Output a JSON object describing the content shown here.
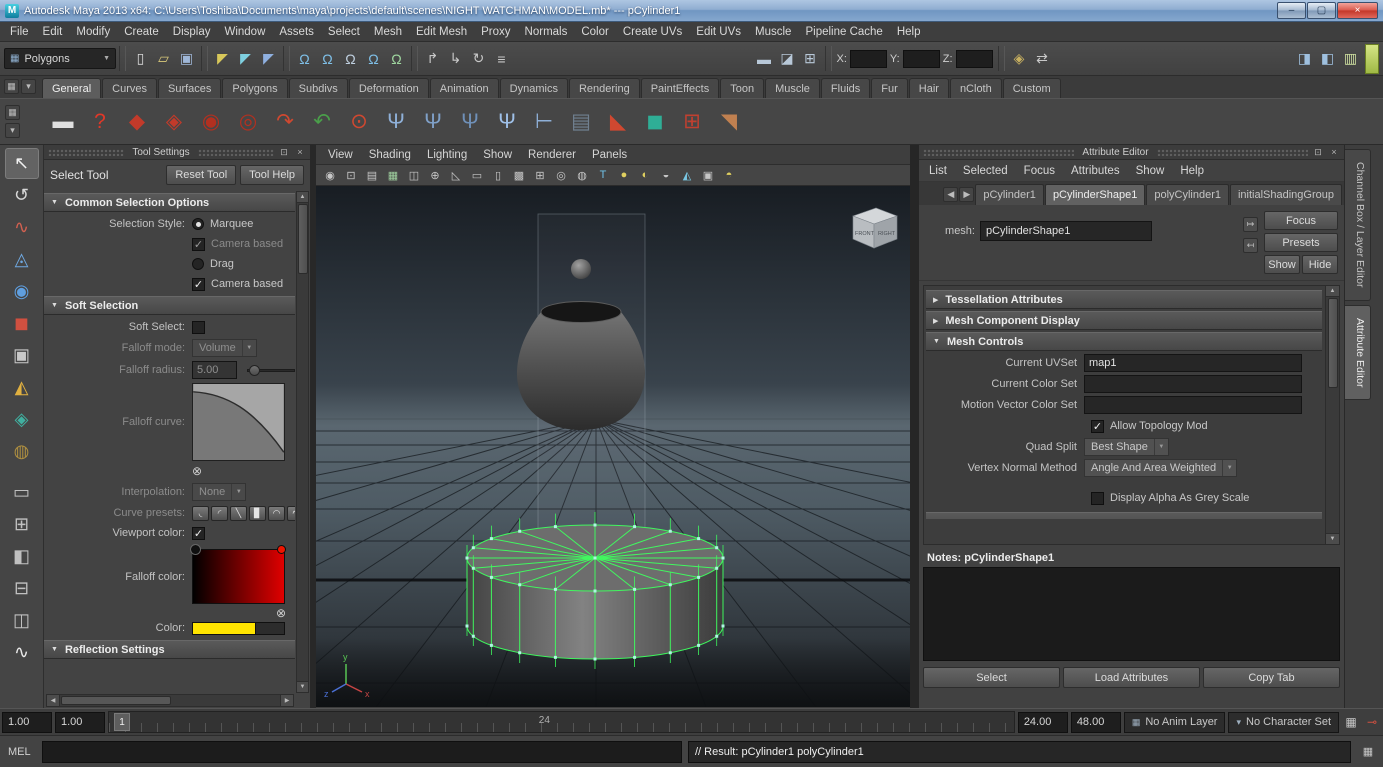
{
  "glyphs": {
    "menu_grid": "▦",
    "menu_arrow": "▾",
    "combo_arrow": "▼",
    "tri_down": "▼",
    "tri_right": "▶",
    "tri_up": "▲",
    "tri_left": "◀",
    "check": "✓",
    "close": "×",
    "dock": "⊡",
    "circle_cross": "⊗",
    "arrow_in": "↦",
    "arrow_out": "↤",
    "min": "–",
    "max": "▢",
    "key": "⊸",
    "maya_badge": "M"
  },
  "titlebar": {
    "title": "Autodesk Maya 2013 x64: C:\\Users\\Toshiba\\Documents\\maya\\projects\\default\\scenes\\NIGHT WATCHMAN\\MODEL.mb*    ---    pCylinder1"
  },
  "menubar": {
    "items": [
      "File",
      "Edit",
      "Modify",
      "Create",
      "Display",
      "Window",
      "Assets",
      "Select",
      "Mesh",
      "Edit Mesh",
      "Proxy",
      "Normals",
      "Color",
      "Create UVs",
      "Edit UVs",
      "Muscle",
      "Pipeline Cache",
      "Help"
    ]
  },
  "statusline": {
    "mode_selector": "Polygons",
    "coord_labels": {
      "x": "X:",
      "y": "Y:",
      "z": "Z:"
    },
    "file_icons": [
      {
        "id": "new-scene-icon",
        "glyph": "▯",
        "color": "#d8d8d8"
      },
      {
        "id": "open-scene-icon",
        "glyph": "▱",
        "color": "#d8c87a"
      },
      {
        "id": "save-scene-icon",
        "glyph": "▣",
        "color": "#9fb7d8"
      }
    ],
    "selection_mask_icons": [
      {
        "id": "select-hierarchy-icon",
        "glyph": "◤",
        "color": "#d8c85a"
      },
      {
        "id": "select-object-icon",
        "glyph": "◤",
        "color": "#7fd0e0"
      },
      {
        "id": "select-component-icon",
        "glyph": "◤",
        "color": "#8fb0e0"
      }
    ],
    "snap_icons": [
      {
        "id": "snap-grid-icon",
        "glyph": "Ω",
        "color": "#7fc0e8"
      },
      {
        "id": "snap-curve-icon",
        "glyph": "Ω",
        "color": "#7fc0e8"
      },
      {
        "id": "snap-point-icon",
        "glyph": "Ω",
        "color": "#c0d0e0"
      },
      {
        "id": "snap-plane-icon",
        "glyph": "Ω",
        "color": "#7fc0e8"
      },
      {
        "id": "make-live-icon",
        "glyph": "Ω",
        "color": "#a0d8a0"
      }
    ],
    "history_icons": [
      {
        "id": "input-connection-icon",
        "glyph": "↱",
        "color": "#c8c8c8"
      },
      {
        "id": "output-connection-icon",
        "glyph": "↳",
        "color": "#c8c8c8"
      },
      {
        "id": "construction-history-icon",
        "glyph": "↻",
        "color": "#c8c8c8"
      },
      {
        "id": "list-input-operations-icon",
        "glyph": "≡",
        "color": "#c8c8c8"
      }
    ],
    "render_icons": [
      {
        "id": "render-current-frame-icon",
        "glyph": "▬",
        "color": "#b8c8d8"
      },
      {
        "id": "ipr-render-icon",
        "glyph": "◪",
        "color": "#b8c8d8"
      },
      {
        "id": "render-settings-icon",
        "glyph": "⊞",
        "color": "#b8c8d8"
      }
    ],
    "misc_icons": [
      {
        "id": "hypershade-icon",
        "glyph": "◈",
        "color": "#c8b060"
      },
      {
        "id": "toggle-panels-icon",
        "glyph": "⇄",
        "color": "#c8c8c8"
      }
    ],
    "editor_toggle_icons": [
      {
        "id": "attribute-editor-toggle-icon",
        "glyph": "◨",
        "color": "#9fc0df"
      },
      {
        "id": "tool-settings-toggle-icon",
        "glyph": "◧",
        "color": "#9fc0df"
      },
      {
        "id": "channel-box-toggle-icon",
        "glyph": "▥",
        "color": "#cfe0a0"
      }
    ]
  },
  "shelf": {
    "tabs": [
      {
        "id": "general",
        "label": "General",
        "active": true
      },
      {
        "id": "curves",
        "label": "Curves"
      },
      {
        "id": "surfaces",
        "label": "Surfaces"
      },
      {
        "id": "polygons",
        "label": "Polygons"
      },
      {
        "id": "subdivs",
        "label": "Subdivs"
      },
      {
        "id": "deformation",
        "label": "Deformation"
      },
      {
        "id": "animation",
        "label": "Animation"
      },
      {
        "id": "dynamics",
        "label": "Dynamics"
      },
      {
        "id": "rendering",
        "label": "Rendering"
      },
      {
        "id": "painteffects",
        "label": "PaintEffects"
      },
      {
        "id": "toon",
        "label": "Toon"
      },
      {
        "id": "muscle",
        "label": "Muscle"
      },
      {
        "id": "fluids",
        "label": "Fluids"
      },
      {
        "id": "fur",
        "label": "Fur"
      },
      {
        "id": "hair",
        "label": "Hair"
      },
      {
        "id": "ncloth",
        "label": "nCloth"
      },
      {
        "id": "custom",
        "label": "Custom"
      }
    ],
    "icons": [
      {
        "id": "shelf-clapperboard-icon",
        "glyph": "▬",
        "color": "#e0e0e0"
      },
      {
        "id": "shelf-help-icon",
        "glyph": "?",
        "color": "#e03828"
      },
      {
        "id": "shelf-creature-a-icon",
        "glyph": "◆",
        "color": "#c23a2a"
      },
      {
        "id": "shelf-creature-b-icon",
        "glyph": "◈",
        "color": "#c23a2a"
      },
      {
        "id": "shelf-creature-c-icon",
        "glyph": "◉",
        "color": "#b23020"
      },
      {
        "id": "shelf-creature-d-icon",
        "glyph": "◎",
        "color": "#b23020"
      },
      {
        "id": "shelf-redo-arrow-icon",
        "glyph": "↷",
        "color": "#d04830"
      },
      {
        "id": "shelf-undo-arrow-icon",
        "glyph": "↶",
        "color": "#4a9f4a"
      },
      {
        "id": "shelf-joint-icon",
        "glyph": "⊙",
        "color": "#d04830"
      },
      {
        "id": "shelf-bone-a-icon",
        "glyph": "Ψ",
        "color": "#8fb0d8"
      },
      {
        "id": "shelf-bone-b-icon",
        "glyph": "Ψ",
        "color": "#7fa0c8"
      },
      {
        "id": "shelf-bone-c-icon",
        "glyph": "Ψ",
        "color": "#6f90b8"
      },
      {
        "id": "shelf-bone-d-icon",
        "glyph": "Ψ",
        "color": "#9fc0e8"
      },
      {
        "id": "shelf-ik-handle-icon",
        "glyph": "⊢",
        "color": "#8fb0d8"
      },
      {
        "id": "shelf-graph-icon",
        "glyph": "▤",
        "color": "#708090"
      },
      {
        "id": "shelf-paint-icon",
        "glyph": "◣",
        "color": "#d04830"
      },
      {
        "id": "shelf-cube-icon",
        "glyph": "◼",
        "color": "#2fae96"
      },
      {
        "id": "shelf-duplicate-icon",
        "glyph": "⊞",
        "color": "#c04030"
      },
      {
        "id": "shelf-brush-icon",
        "glyph": "◥",
        "color": "#c08050"
      }
    ]
  },
  "toolbox": {
    "tool_icons": [
      {
        "id": "select-tool-icon",
        "glyph": "↖",
        "color": "#f0f0f0",
        "active": true
      },
      {
        "id": "lasso-select-tool-icon",
        "glyph": "↺",
        "color": "#d8d8d8"
      },
      {
        "id": "paint-select-tool-icon",
        "glyph": "∿",
        "color": "#d06050"
      },
      {
        "id": "move-tool-icon",
        "glyph": "◬",
        "color": "#6fa8e0"
      },
      {
        "id": "rotate-tool-icon",
        "glyph": "◉",
        "color": "#5f9fe0"
      },
      {
        "id": "scale-tool-icon",
        "glyph": "◼",
        "color": "#d05040"
      },
      {
        "id": "universal-manipulator-icon",
        "glyph": "▣",
        "color": "#c8c8c8"
      },
      {
        "id": "soft-modification-tool-icon",
        "glyph": "◭",
        "color": "#e0b040"
      },
      {
        "id": "show-manipulator-tool-icon",
        "glyph": "◈",
        "color": "#40b0a0"
      },
      {
        "id": "last-tool-used-icon",
        "glyph": "◍",
        "color": "#b09040"
      }
    ],
    "layout_icons": [
      {
        "id": "single-pane-layout-icon",
        "glyph": "▭",
        "color": "#c0c0c0"
      },
      {
        "id": "four-pane-layout-icon",
        "glyph": "⊞",
        "color": "#c0c0c0"
      },
      {
        "id": "persp-outliner-layout-icon",
        "glyph": "◧",
        "color": "#c0c0c0"
      },
      {
        "id": "persp-graph-layout-icon",
        "glyph": "⊟",
        "color": "#c0c0c0"
      },
      {
        "id": "hypershade-persp-layout-icon",
        "glyph": "◫",
        "color": "#c0c0c0"
      },
      {
        "id": "sculpt-reference-icon",
        "glyph": "∿",
        "color": "#e8e8e8"
      }
    ]
  },
  "tool_settings": {
    "panel_title": "Tool Settings",
    "tool_name": "Select Tool",
    "reset_button": "Reset Tool",
    "help_button": "Tool Help",
    "section_common": "Common Selection Options",
    "section_soft": "Soft Selection",
    "section_reflection": "Reflection Settings",
    "selection_style_label": "Selection Style:",
    "marquee_label": "Marquee",
    "camera_based_1_label": "Camera based",
    "drag_label": "Drag",
    "camera_based_2_label": "Camera based",
    "soft_select_label": "Soft Select:",
    "falloff_mode_label": "Falloff mode:",
    "falloff_mode_value": "Volume",
    "falloff_radius_label": "Falloff radius:",
    "falloff_radius_value": "5.00",
    "falloff_curve_label": "Falloff curve:",
    "interpolation_label": "Interpolation:",
    "interpolation_value": "None",
    "curve_presets_label": "Curve presets:",
    "curve_presets": [
      {
        "id": "preset-soft-icon",
        "glyph": "◟"
      },
      {
        "id": "preset-medium-icon",
        "glyph": "◜"
      },
      {
        "id": "preset-linear-icon",
        "glyph": "╲"
      },
      {
        "id": "preset-hard-icon",
        "glyph": "▊"
      },
      {
        "id": "preset-crater-icon",
        "glyph": "◠"
      },
      {
        "id": "preset-wave-icon",
        "glyph": "∿"
      }
    ],
    "viewport_color_label": "Viewport color:",
    "falloff_color_label": "Falloff color:",
    "color_label": "Color:"
  },
  "viewport": {
    "menus": [
      "View",
      "Shading",
      "Lighting",
      "Show",
      "Renderer",
      "Panels"
    ],
    "toolbar_icons": [
      {
        "id": "select-camera-icon",
        "glyph": "◉",
        "color": "#c6c6c6"
      },
      {
        "id": "lock-camera-icon",
        "glyph": "⊡",
        "color": "#c6c6c6"
      },
      {
        "id": "camera-attributes-icon",
        "glyph": "▤",
        "color": "#c6c6c6"
      },
      {
        "id": "bookmarks-icon",
        "glyph": "▦",
        "color": "#9fd09f"
      },
      {
        "id": "image-plane-icon",
        "glyph": "◫",
        "color": "#c6c6c6"
      },
      {
        "id": "2d-pan-zoom-icon",
        "glyph": "⊕",
        "color": "#c6c6c6"
      },
      {
        "id": "grease-pencil-icon",
        "glyph": "◺",
        "color": "#c6c6c6"
      },
      {
        "id": "film-gate-icon",
        "glyph": "▭",
        "color": "#c6c6c6"
      },
      {
        "id": "resolution-gate-icon",
        "glyph": "▯",
        "color": "#c6c6c6"
      },
      {
        "id": "gate-mask-icon",
        "glyph": "▩",
        "color": "#c6c6c6"
      },
      {
        "id": "field-chart-icon",
        "glyph": "⊞",
        "color": "#c6c6c6"
      },
      {
        "id": "safe-action-icon",
        "glyph": "◎",
        "color": "#c6c6c6"
      },
      {
        "id": "safe-title-icon",
        "glyph": "◍",
        "color": "#c6c6c6"
      },
      {
        "id": "textured-display-icon",
        "glyph": "T",
        "color": "#6fc2e8"
      },
      {
        "id": "default-lighting-icon",
        "glyph": "●",
        "color": "#e0d060"
      },
      {
        "id": "shadows-icon",
        "glyph": "◐",
        "color": "#e0d060"
      },
      {
        "id": "occlusion-icon",
        "glyph": "◒",
        "color": "#c6c6c6"
      },
      {
        "id": "xray-icon",
        "glyph": "◭",
        "color": "#79c7e3"
      },
      {
        "id": "isolate-select-icon",
        "glyph": "▣",
        "color": "#c6c6c6"
      },
      {
        "id": "exposure-icon",
        "glyph": "◓",
        "color": "#e0d060"
      }
    ],
    "view_cube": {
      "front": "FRONT",
      "right": "RIGHT"
    },
    "axis": {
      "x": "x",
      "y": "y",
      "z": "z"
    }
  },
  "attribute_editor": {
    "panel_title": "Attribute Editor",
    "menus": [
      "List",
      "Selected",
      "Focus",
      "Attributes",
      "Show",
      "Help"
    ],
    "tabs": [
      {
        "id": "pcylinder1",
        "label": "pCylinder1"
      },
      {
        "id": "pcylindershape1",
        "label": "pCylinderShape1",
        "active": true
      },
      {
        "id": "polycylinder1",
        "label": "polyCylinder1"
      },
      {
        "id": "initialshadinggroup",
        "label": "initialShadingGroup"
      }
    ],
    "mesh_label": "mesh:",
    "mesh_value": "pCylinderShape1",
    "focus_button": "Focus",
    "presets_button": "Presets",
    "show_button": "Show",
    "hide_button": "Hide",
    "section_tessellation": "Tessellation Attributes",
    "section_component_display": "Mesh Component Display",
    "section_mesh_controls": "Mesh Controls",
    "current_uvset_label": "Current UVSet",
    "current_uvset_value": "map1",
    "current_color_set_label": "Current Color Set",
    "current_color_set_value": "",
    "motion_vector_label": "Motion Vector Color Set",
    "motion_vector_value": "",
    "allow_topology_label": "Allow Topology Mod",
    "quad_split_label": "Quad Split",
    "quad_split_value": "Best Shape",
    "vertex_normal_label": "Vertex Normal Method",
    "vertex_normal_value": "Angle And Area Weighted",
    "display_alpha_label": "Display Alpha As Grey Scale",
    "notes_label": "Notes:",
    "notes_value": "pCylinderShape1",
    "select_button": "Select",
    "load_attributes_button": "Load Attributes",
    "copy_tab_button": "Copy Tab"
  },
  "right_dock": {
    "tabs": [
      {
        "id": "channel-box-layer-editor-tab",
        "label": "Channel Box / Layer Editor"
      },
      {
        "id": "attribute-editor-tab",
        "label": "Attribute Editor",
        "active": true
      }
    ]
  },
  "timeline": {
    "range_start": "1.00",
    "playback_start": "1.00",
    "current_frame": "1",
    "mid_frame_label": "24",
    "playback_end": "24.00",
    "range_end": "48.00",
    "anim_layer": "No Anim Layer",
    "character_set": "No Character Set"
  },
  "command_line": {
    "label": "MEL",
    "input_value": "",
    "result": "// Result: pCylinder1 polyCylinder1 "
  }
}
